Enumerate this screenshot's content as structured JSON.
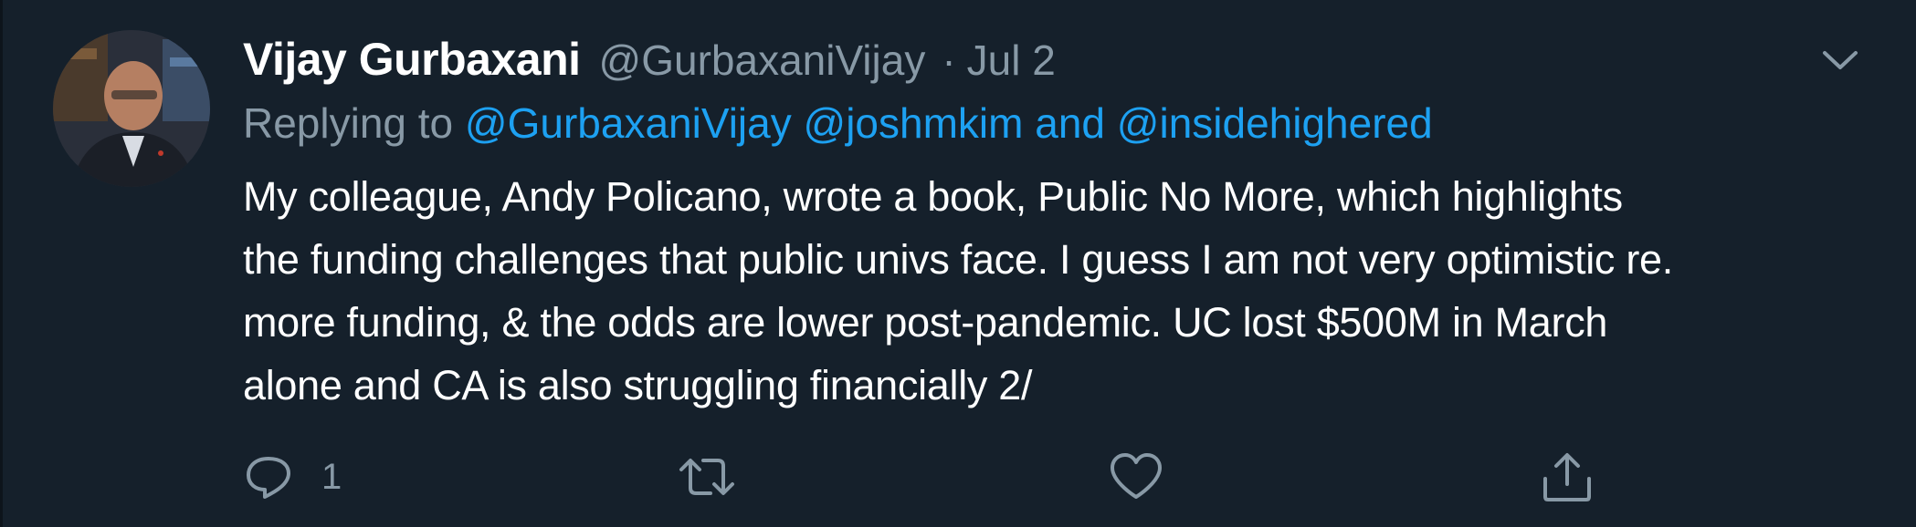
{
  "tweet": {
    "author": {
      "display_name": "Vijay Gurbaxani",
      "handle": "@GurbaxaniVijay",
      "avatar_icon": "profile-photo"
    },
    "separator": "·",
    "date": "Jul 2",
    "replying": {
      "prefix": "Replying to",
      "mention_1": "@GurbaxaniVijay",
      "mention_2": "@joshmkim",
      "conjunction": "and",
      "mention_3": "@insidehighered"
    },
    "text_lines": [
      "My colleague, Andy Policano, wrote a book, Public No More, which highlights",
      "the funding challenges that public univs face. I guess I am not very optimistic re.",
      "more funding, & the odds are lower post-pandemic. UC lost $500M in March",
      "alone and CA is also struggling financially 2/"
    ],
    "actions": {
      "reply_count": "1",
      "reply_icon": "reply-icon",
      "retweet_icon": "retweet-icon",
      "like_icon": "heart-icon",
      "share_icon": "share-icon"
    }
  },
  "colors": {
    "background": "#15202b",
    "primary_text": "#ffffff",
    "secondary_text": "#8899a6",
    "link": "#1da1f2"
  }
}
